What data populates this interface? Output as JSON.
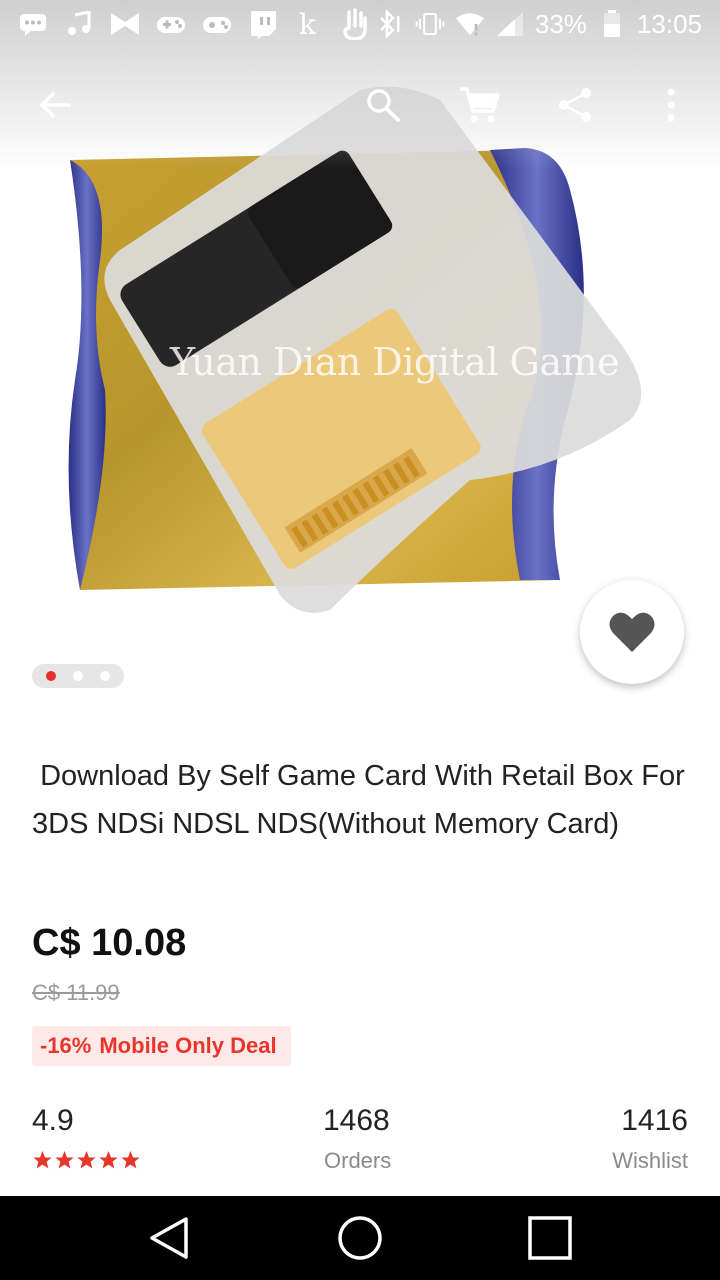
{
  "status_bar": {
    "battery_percent": "33%",
    "time": "13:05",
    "icons": [
      "chat-icon",
      "music-icon",
      "bowtie-icon",
      "gamepad-icon",
      "gamepad-alt-icon",
      "twitch-icon",
      "k-icon",
      "hand-icon",
      "bluetooth-icon",
      "vibrate-icon",
      "wifi-icon",
      "signal-icon",
      "battery-icon"
    ]
  },
  "toolbar": {
    "icons": [
      "back-arrow-icon",
      "search-icon",
      "cart-icon",
      "share-icon",
      "more-vert-icon"
    ]
  },
  "gallery": {
    "watermark": "Yuan Dian Digital Game",
    "page_count": 3,
    "active_page": 1
  },
  "product": {
    "title": " Download By Self Game Card With Retail Box For 3DS NDSi NDSL NDS(Without Memory Card)",
    "price": "C$ 10.08",
    "old_price": "C$ 11.99",
    "discount": "-16%",
    "deal_label": "Mobile Only Deal",
    "rating": "4.9",
    "rating_stars": 5,
    "orders_count": "1468",
    "orders_label": "Orders",
    "wishlist_count": "1416",
    "wishlist_label": "Wishlist"
  },
  "colors": {
    "accent_red": "#e62e2e",
    "deal_bg": "#fde9e8",
    "star_red": "#e8362d"
  },
  "nav_bar": {
    "icons": [
      "back-triangle-icon",
      "home-circle-icon",
      "recents-square-icon"
    ]
  }
}
